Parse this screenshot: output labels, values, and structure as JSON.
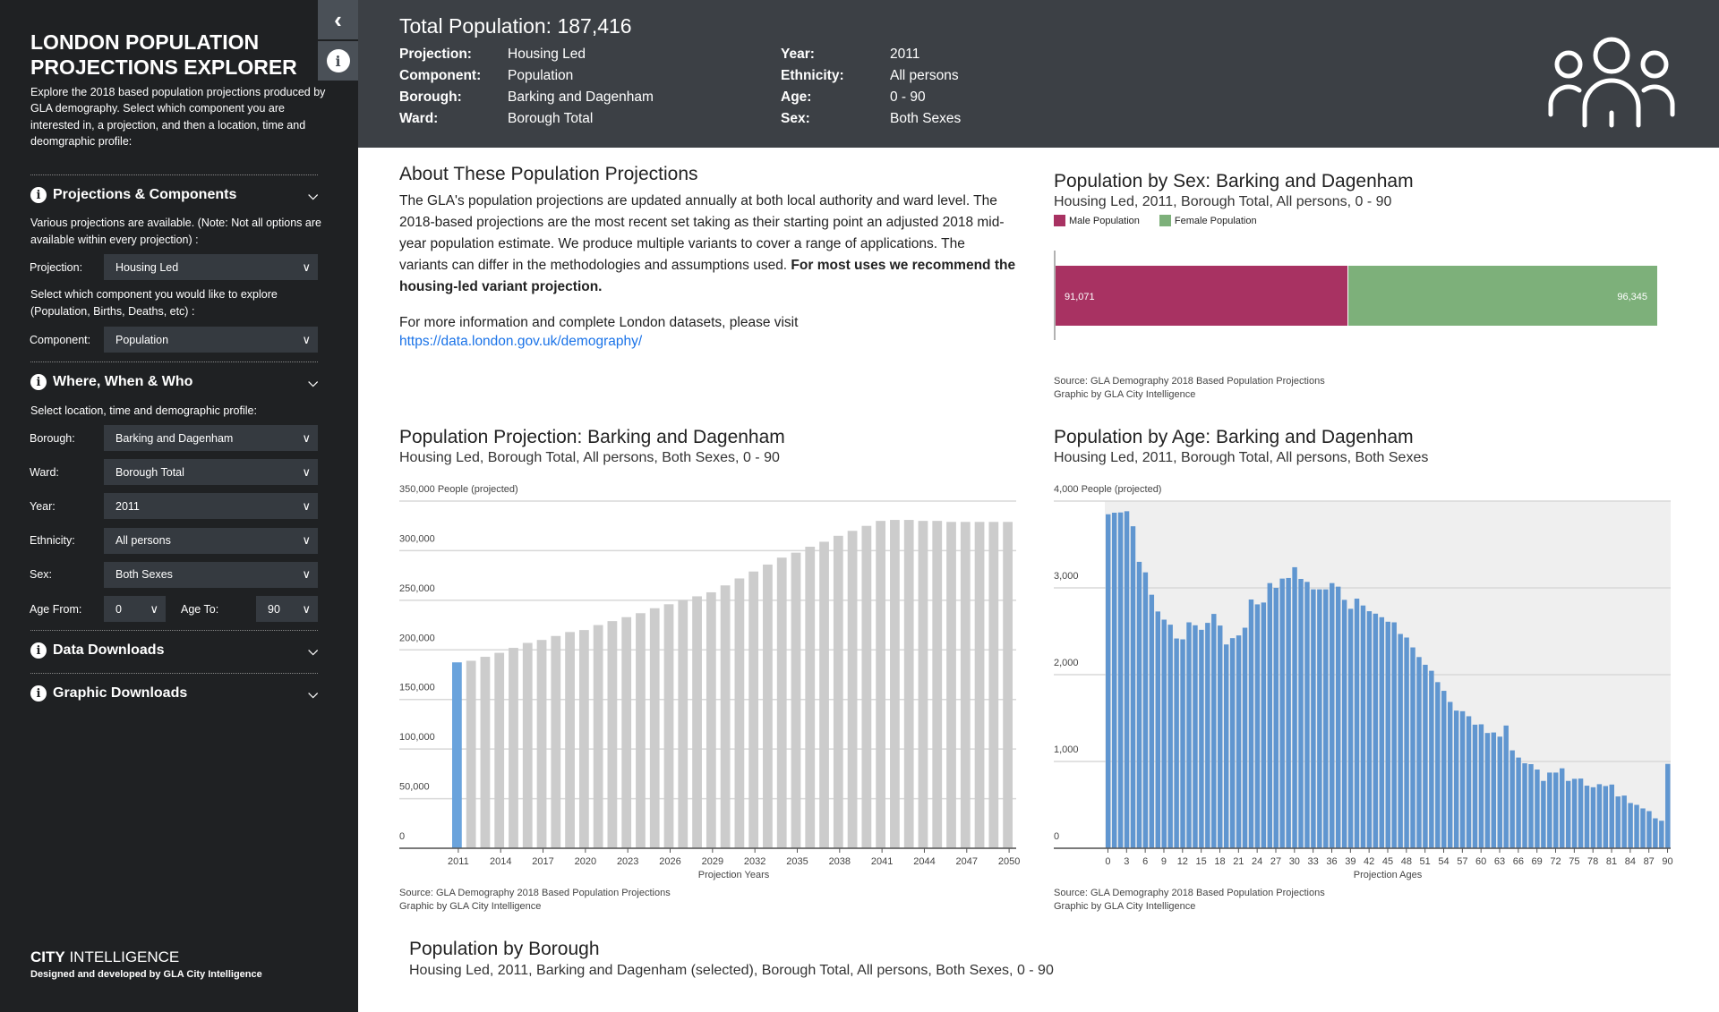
{
  "sidebar": {
    "title": "LONDON POPULATION PROJECTIONS EXPLORER",
    "description": "Explore the 2018 based population projections produced by GLA demography. Select which component you are interested in, a projection, and then a location, time and deomgraphic profile:",
    "sections": {
      "projections": {
        "title": "Projections & Components",
        "note": "Various projections are available. (Note: Not all options are available within every projection) :",
        "projection_label": "Projection:",
        "projection_value": "Housing Led",
        "component_note": "Select which component you would like to explore (Population, Births, Deaths, etc) :",
        "component_label": "Component:",
        "component_value": "Population"
      },
      "where": {
        "title": "Where, When & Who",
        "note": "Select location, time and demographic profile:",
        "fields": [
          {
            "label": "Borough:",
            "value": "Barking and Dagenham"
          },
          {
            "label": "Ward:",
            "value": "Borough Total"
          },
          {
            "label": "Year:",
            "value": "2011"
          },
          {
            "label": "Ethnicity:",
            "value": "All persons"
          },
          {
            "label": "Sex:",
            "value": "Both Sexes"
          }
        ],
        "age_from_label": "Age From:",
        "age_from": "0",
        "age_to_label": "Age To:",
        "age_to": "90"
      },
      "data_downloads": {
        "title": "Data Downloads"
      },
      "graphic_downloads": {
        "title": "Graphic Downloads"
      }
    },
    "footer_brand_bold": "CITY",
    "footer_brand": " INTELLIGENCE",
    "footer_credit": "Designed and developed by GLA City Intelligence"
  },
  "header": {
    "total": "Total Population: 187,416",
    "left": [
      {
        "k": "Projection:",
        "v": "Housing Led"
      },
      {
        "k": "Component:",
        "v": "Population"
      },
      {
        "k": "Borough:",
        "v": "Barking and Dagenham"
      },
      {
        "k": "Ward:",
        "v": "Borough Total"
      }
    ],
    "right": [
      {
        "k": "Year:",
        "v": "2011"
      },
      {
        "k": "Ethnicity:",
        "v": "All persons"
      },
      {
        "k": "Age:",
        "v": "0 - 90"
      },
      {
        "k": "Sex:",
        "v": "Both Sexes"
      }
    ]
  },
  "about": {
    "title": "About These Population Projections",
    "text": "The GLA's population projections are updated annually at both local authority and ward level. The 2018-based projections are the most recent set taking as their starting point an adjusted 2018 mid-year population estimate. We produce multiple variants to cover a range of applications. The variants can differ in the methodologies and assumptions used. ",
    "text_bold": "For most uses we recommend the housing-led variant projection.",
    "more": "For more information and complete London datasets, please visit",
    "link": "https://data.london.gov.uk/demography/"
  },
  "borough": {
    "title": "Population by Borough",
    "subtitle": "Housing Led, 2011, Barking and Dagenham (selected), Borough Total, All persons, Both Sexes, 0 - 90"
  },
  "source": "Source: GLA Demography 2018 Based Population Projections",
  "credit": "Graphic by GLA City Intelligence",
  "chart_data": [
    {
      "type": "bar",
      "orientation": "horizontal-stacked",
      "title": "Population by Sex: Barking and Dagenham",
      "subtitle": "Housing Led, 2011, Borough Total, All persons, 0 - 90",
      "series": [
        {
          "name": "Male Population",
          "value": 91071,
          "label": "91,071",
          "color": "#a83262"
        },
        {
          "name": "Female Population",
          "value": 96345,
          "label": "96,345",
          "color": "#7db07a"
        }
      ]
    },
    {
      "type": "bar",
      "title": "Population Projection: Barking and Dagenham",
      "subtitle": "Housing Led, Borough Total, All persons, Both Sexes, 0 - 90",
      "ylabel": "People (projected)",
      "xlabel": "Projection Years",
      "ylim": [
        0,
        350000
      ],
      "yticks": [
        "0",
        "50,000",
        "100,000",
        "150,000",
        "200,000",
        "250,000",
        "300,000",
        "350,000"
      ],
      "xticks": [
        "2011",
        "2014",
        "2017",
        "2020",
        "2023",
        "2026",
        "2029",
        "2032",
        "2035",
        "2038",
        "2041",
        "2044",
        "2047",
        "2050"
      ],
      "highlight": "2011",
      "highlight_color": "#6aa3dc",
      "bar_color": "#cccccc",
      "x": [
        2011,
        2012,
        2013,
        2014,
        2015,
        2016,
        2017,
        2018,
        2019,
        2020,
        2021,
        2022,
        2023,
        2024,
        2025,
        2026,
        2027,
        2028,
        2029,
        2030,
        2031,
        2032,
        2033,
        2034,
        2035,
        2036,
        2037,
        2038,
        2039,
        2040,
        2041,
        2042,
        2043,
        2044,
        2045,
        2046,
        2047,
        2048,
        2049,
        2050
      ],
      "values": [
        187416,
        189000,
        193000,
        197000,
        202000,
        207000,
        210000,
        214000,
        218000,
        220000,
        225000,
        229000,
        233000,
        237000,
        242000,
        246000,
        250000,
        254000,
        258000,
        265000,
        272000,
        279000,
        286000,
        293000,
        298000,
        304000,
        309000,
        315000,
        320000,
        325000,
        330000,
        331000,
        331000,
        330000,
        330000,
        329000,
        329000,
        329000,
        329000,
        329000
      ]
    },
    {
      "type": "bar",
      "title": "Population by Age: Barking and Dagenham",
      "subtitle": "Housing Led, 2011, Borough Total, All persons, Both Sexes",
      "ylabel": "People (projected)",
      "xlabel": "Projection Ages",
      "ylim": [
        0,
        4000
      ],
      "yticks": [
        "0",
        "1,000",
        "2,000",
        "3,000",
        "4,000"
      ],
      "xticks": [
        "0",
        "3",
        "6",
        "9",
        "12",
        "15",
        "18",
        "21",
        "24",
        "27",
        "30",
        "33",
        "36",
        "39",
        "42",
        "45",
        "48",
        "51",
        "54",
        "57",
        "60",
        "63",
        "66",
        "69",
        "72",
        "75",
        "78",
        "81",
        "84",
        "87",
        "90"
      ],
      "bar_color": "#6096d0",
      "values": [
        3848,
        3866,
        3869,
        3883,
        3710,
        3300,
        3179,
        2921,
        2728,
        2634,
        2576,
        2417,
        2407,
        2603,
        2569,
        2517,
        2597,
        2700,
        2566,
        2348,
        2421,
        2452,
        2541,
        2866,
        2810,
        2831,
        3055,
        3000,
        3107,
        3114,
        3238,
        3103,
        3069,
        2983,
        2983,
        2983,
        3055,
        3014,
        2862,
        2759,
        2876,
        2797,
        2731,
        2703,
        2662,
        2610,
        2603,
        2469,
        2428,
        2314,
        2203,
        2114,
        2045,
        1914,
        1814,
        1686,
        1586,
        1579,
        1521,
        1424,
        1428,
        1328,
        1334,
        1286,
        1414,
        1128,
        1045,
        979,
        969,
        907,
        776,
        872,
        872,
        921,
        776,
        800,
        803,
        721,
        703,
        738,
        717,
        734,
        597,
        607,
        521,
        500,
        459,
        428,
        345,
        317,
        972
      ]
    }
  ]
}
